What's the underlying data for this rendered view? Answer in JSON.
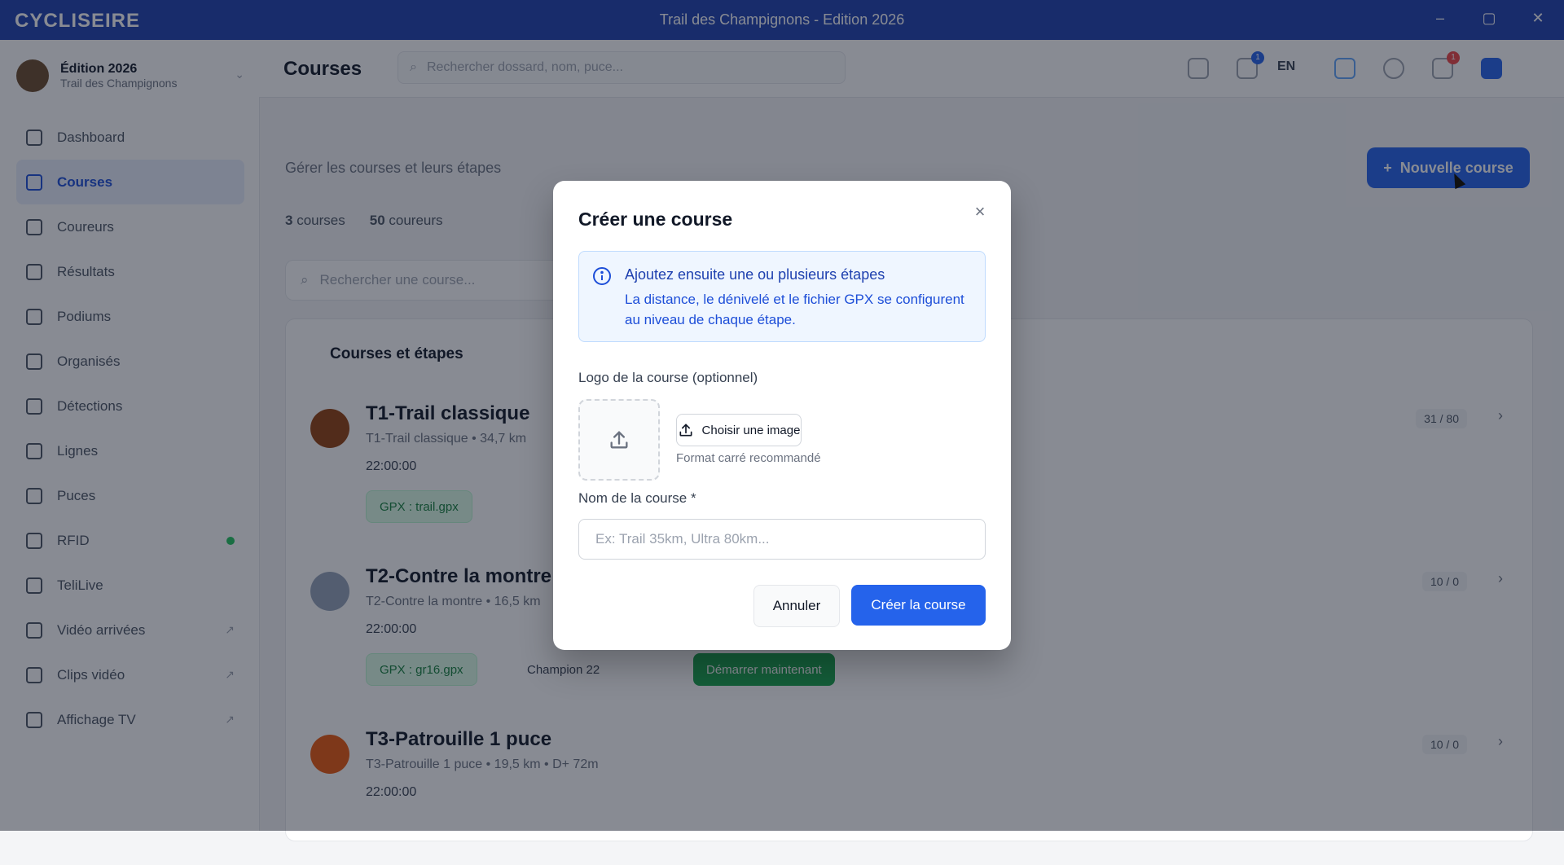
{
  "window": {
    "brand": "CYCLISEIRE",
    "title": "Trail des Champignons - Edition 2026",
    "controls": [
      "–",
      "▢",
      "✕"
    ]
  },
  "sidebar": {
    "event_name": "Édition 2026",
    "event_sub": "Trail des Champignons",
    "items": [
      {
        "label": "Dashboard",
        "icon": "dashboard-icon"
      },
      {
        "label": "Courses",
        "icon": "route-icon",
        "active": true
      },
      {
        "label": "Coureurs",
        "icon": "runners-icon"
      },
      {
        "label": "Résultats",
        "icon": "results-icon"
      },
      {
        "label": "Podiums",
        "icon": "podium-icon"
      },
      {
        "label": "Organisés",
        "icon": "users-icon"
      },
      {
        "label": "Détections",
        "icon": "detection-icon"
      },
      {
        "label": "Lignes",
        "icon": "lines-icon"
      },
      {
        "label": "Puces",
        "icon": "chip-icon"
      },
      {
        "label": "RFID",
        "icon": "rfid-icon",
        "status": "online"
      },
      {
        "label": "TeliLive",
        "icon": "live-icon"
      },
      {
        "label": "Vidéo arrivées",
        "icon": "video-icon",
        "external": true
      },
      {
        "label": "Clips vidéo",
        "icon": "clips-icon",
        "external": true
      },
      {
        "label": "Affichage TV",
        "icon": "tv-icon",
        "external": true
      }
    ]
  },
  "topbar": {
    "page_title": "Courses",
    "search_placeholder": "Rechercher dossard, nom, puce...",
    "lang": "EN",
    "badge_tasks": "1",
    "badge_notifications": "1"
  },
  "main": {
    "subtitle": "Gérer les courses et leurs étapes",
    "new_button": "Nouvelle course",
    "stats": {
      "courses_count": "3",
      "courses_label": "courses",
      "runners_count": "50",
      "runners_label": "coureurs"
    },
    "course_search_placeholder": "Rechercher une course...",
    "panel_title": "Courses et étapes",
    "courses": [
      {
        "name": "T1-Trail classique",
        "meta": "T1-Trail classique • 34,7 km",
        "time": "22:00:00",
        "chip": "GPX : trail.gpx",
        "count": "31 / 80"
      },
      {
        "name": "T2-Contre la montre",
        "meta": "T2-Contre la montre • 16,5 km",
        "time": "22:00:00",
        "chip": "GPX : gr16.gpx",
        "chip2": "Champion 22",
        "chip3": "Démarrer maintenant",
        "count": "10 / 0"
      },
      {
        "name": "T3-Patrouille 1 puce",
        "meta": "T3-Patrouille 1 puce • 19,5 km • D+ 72m",
        "time": "22:00:00",
        "count": "10 / 0"
      }
    ]
  },
  "modal": {
    "title": "Créer une course",
    "info_title": "Ajoutez ensuite une ou plusieurs étapes",
    "info_text": "La distance, le dénivelé et le fichier GPX se configurent au niveau de chaque étape.",
    "logo_label": "Logo de la course (optionnel)",
    "choose_button": "Choisir une image",
    "hint": "Format carré recommandé",
    "name_label": "Nom de la course *",
    "name_placeholder": "Ex: Trail 35km, Ultra 80km...",
    "name_value": "",
    "cancel_button": "Annuler",
    "create_button": "Créer la course"
  },
  "colors": {
    "primary": "#2563eb",
    "titlebar": "#1e40af",
    "info_bg": "#eff6ff",
    "success": "#16a34a"
  }
}
